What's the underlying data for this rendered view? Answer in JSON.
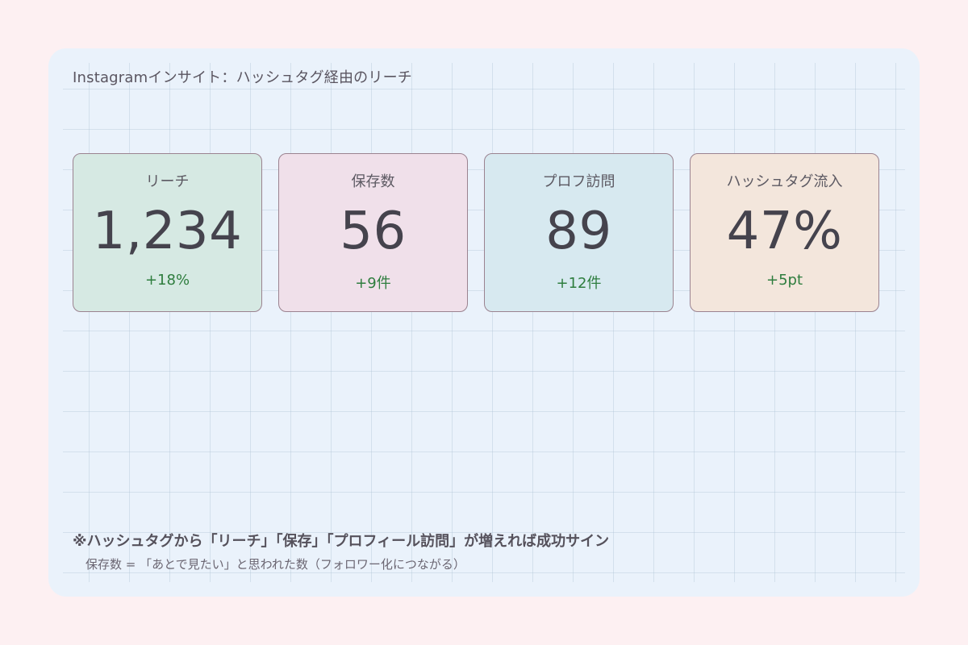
{
  "title": "Instagramインサイト：ハッシュタグ経由のリーチ",
  "cards": [
    {
      "label": "リーチ",
      "value": "1,234",
      "delta": "+18%",
      "bg": "#d6e9e3"
    },
    {
      "label": "保存数",
      "value": "56",
      "delta": "+9件",
      "bg": "#f0e0ea"
    },
    {
      "label": "プロフ訪問",
      "value": "89",
      "delta": "+12件",
      "bg": "#d7e9f0"
    },
    {
      "label": "ハッシュタグ流入",
      "value": "47%",
      "delta": "+5pt",
      "bg": "#f3e6dc"
    }
  ],
  "notes": {
    "main": "※ハッシュタグから「リーチ」「保存」「プロフィール訪問」が増えれば成功サイン",
    "sub": "保存数 = 「あとで見たい」と思われた数（フォロワー化につながる）"
  },
  "colors": {
    "background": "#fdf0f2",
    "panel": "#eaf2fb",
    "positive": "#2e7d3e"
  }
}
